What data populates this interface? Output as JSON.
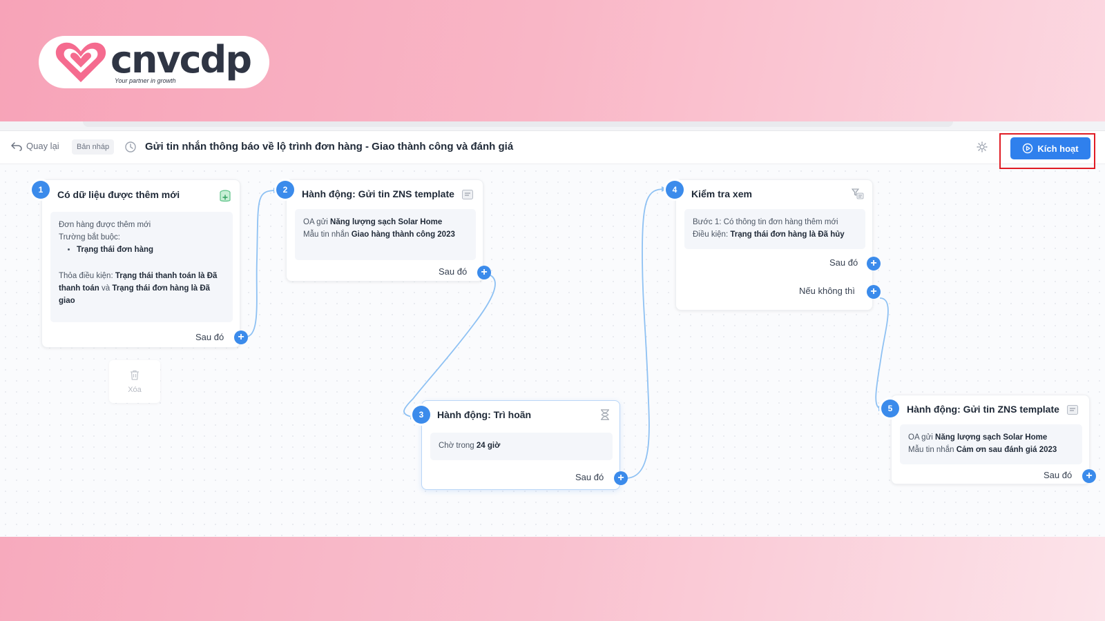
{
  "logo": {
    "wordmark": "cnvcdp",
    "tagline": "Your partner in growth",
    "heart_color": "#f56b8f"
  },
  "toolbar": {
    "back_label": "Quay lại",
    "draft_badge": "Bản nháp",
    "title": "Gửi tin nhắn thông báo về lộ trình đơn hàng - Giao thành công và đánh giá",
    "activate_label": "Kích hoạt",
    "accent_color": "#2f80ed",
    "highlight_color": "#e01b24"
  },
  "delete_label": "Xóa",
  "steps": {
    "s1": {
      "number": "1",
      "title": "Có dữ liệu được thêm mới",
      "icon": "database-add-icon",
      "line1": "Đơn hàng được thêm mới",
      "line2": "Trường bắt buộc:",
      "bullet": "Trạng thái đơn hàng",
      "cond_prefix": "Thỏa điều kiện:",
      "cond_a": "Trạng thái thanh toán là Đã thanh toán",
      "cond_and": "và",
      "cond_b": "Trạng thái đơn hàng là Đã giao",
      "next": "Sau đó"
    },
    "s2": {
      "number": "2",
      "title": "Hành động: Gửi tin ZNS template",
      "icon": "message-template-icon",
      "oa_prefix": "OA gửi",
      "oa_name": "Năng lượng sạch Solar Home",
      "tpl_prefix": "Mẫu tin nhắn",
      "tpl_name": "Giao hàng thành công 2023",
      "next": "Sau đó"
    },
    "s3": {
      "number": "3",
      "title": "Hành động: Trì hoãn",
      "icon": "hourglass-icon",
      "wait_prefix": "Chờ trong",
      "wait_value": "24 giờ",
      "next": "Sau đó"
    },
    "s4": {
      "number": "4",
      "title": "Kiểm tra xem",
      "icon": "filter-check-icon",
      "step_line": "Bước 1: Có thông tin đơn hàng thêm mới",
      "cond_prefix": "Điều kiện:",
      "cond_value": "Trạng thái đơn hàng là Đã hủy",
      "next": "Sau đó",
      "else": "Nếu không thì"
    },
    "s5": {
      "number": "5",
      "title": "Hành động: Gửi tin ZNS template",
      "icon": "message-template-icon",
      "oa_prefix": "OA gửi",
      "oa_name": "Năng lượng sạch Solar Home",
      "tpl_prefix": "Mẫu tin nhắn",
      "tpl_name": "Cảm ơn sau đánh giá 2023",
      "next": "Sau đó"
    }
  }
}
